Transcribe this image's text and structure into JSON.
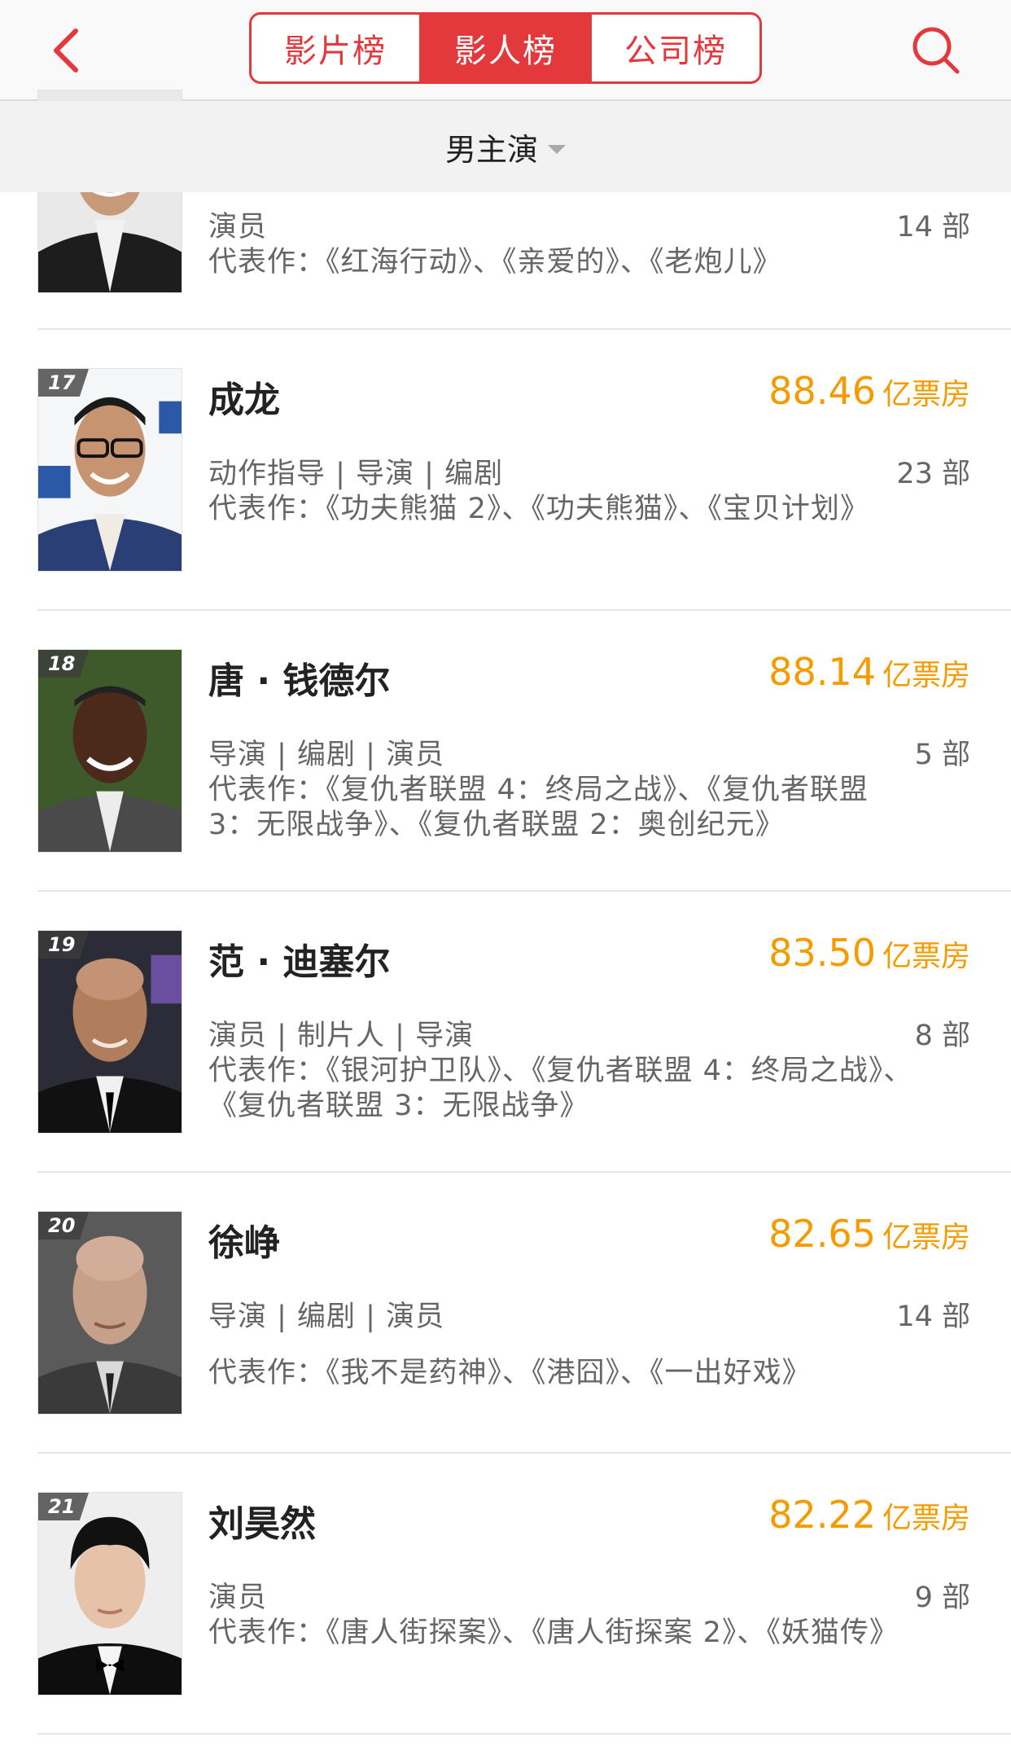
{
  "header": {
    "tabs": [
      {
        "label": "影片榜",
        "active": false
      },
      {
        "label": "影人榜",
        "active": true
      },
      {
        "label": "公司榜",
        "active": false
      }
    ]
  },
  "filter": {
    "label": "男主演"
  },
  "works_prefix": "代表作：",
  "box_unit": "亿票房",
  "partial_row": {
    "roles": "演员",
    "count": "14 部",
    "works": "《红海行动》、《亲爱的》、《老炮儿》"
  },
  "rows": [
    {
      "rank": "17",
      "name": "成龙",
      "box_office": "88.46",
      "roles": "动作指导 | 导演 | 编剧",
      "count": "23 部",
      "works": "《功夫熊猫 2》、《功夫熊猫》、《宝贝计划》"
    },
    {
      "rank": "18",
      "name": "唐 · 钱德尔",
      "box_office": "88.14",
      "roles": "导演 | 编剧 | 演员",
      "count": "5 部",
      "works": "《复仇者联盟 4：终局之战》、《复仇者联盟 3：无限战争》、《复仇者联盟 2：奥创纪元》"
    },
    {
      "rank": "19",
      "name": "范 · 迪塞尔",
      "box_office": "83.50",
      "roles": "演员 | 制片人 | 导演",
      "count": "8 部",
      "works": "《银河护卫队》、《复仇者联盟 4：终局之战》、《复仇者联盟 3：无限战争》"
    },
    {
      "rank": "20",
      "name": "徐峥",
      "box_office": "82.65",
      "roles": "导演 | 编剧 | 演员",
      "count": "14 部",
      "works": "《我不是药神》、《港囧》、《一出好戏》"
    },
    {
      "rank": "21",
      "name": "刘昊然",
      "box_office": "82.22",
      "roles": "演员",
      "count": "9 部",
      "works": "《唐人街探案》、《唐人街探案 2》、《妖猫传》"
    }
  ],
  "colors": {
    "accent": "#e4393c",
    "box_office": "#f59b00"
  },
  "icons": {
    "back": "chevron-left-icon",
    "search": "search-icon",
    "filter_caret": "caret-down-icon"
  }
}
